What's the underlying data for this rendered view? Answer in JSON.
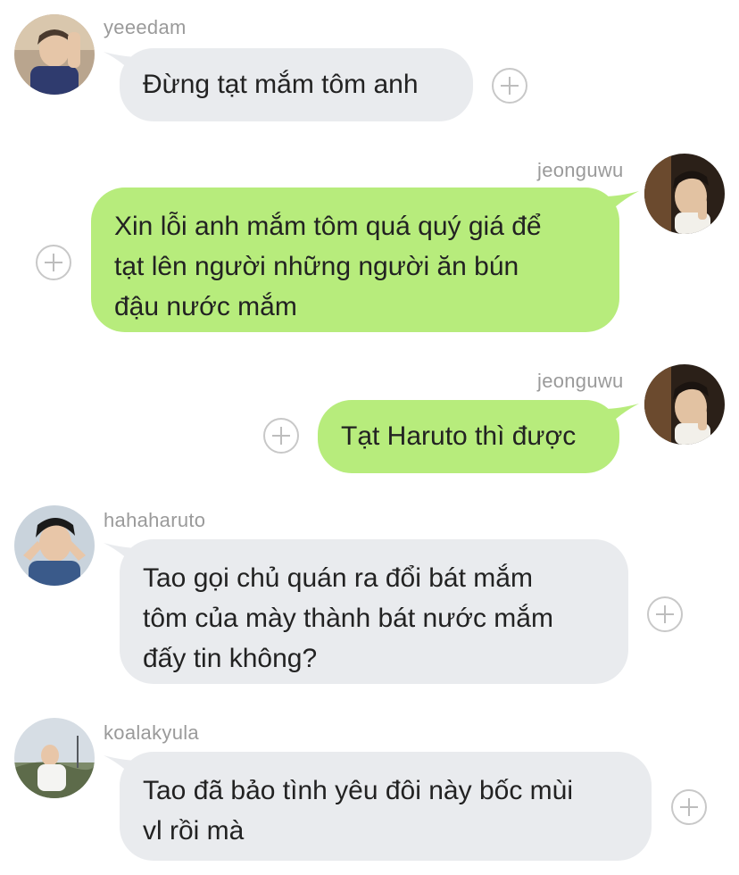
{
  "chat": {
    "messages": [
      {
        "user": "yeeedam",
        "text": "Đừng tạt mắm tôm anh",
        "direction": "incoming"
      },
      {
        "user": "jeonguwu",
        "text": "Xin lỗi anh mắm tôm quá quý giá để\ntạt lên người những người ăn bún\nđậu nước mắm",
        "direction": "outgoing"
      },
      {
        "user": "jeonguwu",
        "text": "Tạt Haruto thì được",
        "direction": "outgoing"
      },
      {
        "user": "hahaharuto",
        "text": "Tao gọi chủ quán ra đổi bát mắm\ntôm của mày thành bát nước mắm\nđấy tin không?",
        "direction": "incoming"
      },
      {
        "user": "koalakyula",
        "text": "Tao đã bảo tình yêu đôi này bốc mùi\nvl rồi mà",
        "direction": "incoming"
      }
    ]
  },
  "colors": {
    "incoming_bubble": "#e9ebee",
    "outgoing_bubble": "#b7ec7c",
    "username": "#9a9a9a"
  },
  "icons": [
    "avatar",
    "add-reaction-plus-icon"
  ]
}
